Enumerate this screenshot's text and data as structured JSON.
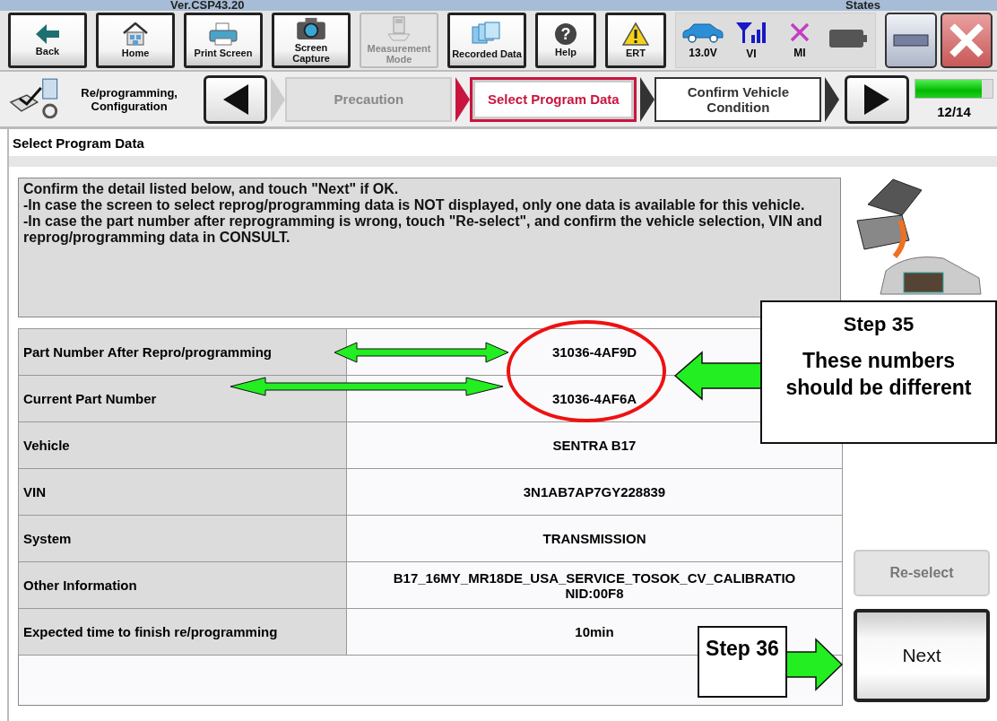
{
  "window": {
    "version": "Ver.CSP43.20",
    "status_label": "States"
  },
  "toolbar": {
    "buttons": [
      {
        "label": "Back",
        "disabled": false
      },
      {
        "label": "Home",
        "disabled": false
      },
      {
        "label": "Print Screen",
        "disabled": false
      },
      {
        "label": "Screen Capture",
        "disabled": false
      },
      {
        "label": "Measurement Mode",
        "disabled": true
      },
      {
        "label": "Recorded Data",
        "disabled": false
      },
      {
        "label": "Help",
        "glyph": "?",
        "disabled": false
      },
      {
        "label": "ERT",
        "disabled": false
      }
    ],
    "status": [
      {
        "label": "13.0V"
      },
      {
        "label": "VI"
      },
      {
        "label": "MI"
      }
    ]
  },
  "breadcrumb": {
    "section": "Re/programming, Configuration",
    "steps": [
      {
        "label": "Precaution",
        "selected": false,
        "disabled": true
      },
      {
        "label": "Select Program Data",
        "selected": true,
        "disabled": false
      },
      {
        "label": "Confirm Vehicle Condition",
        "selected": false,
        "disabled": false
      }
    ],
    "progress": {
      "level": 0.857,
      "text": "12/14"
    }
  },
  "page_title": "Select Program Data",
  "message": [
    "Confirm the detail listed below, and touch \"Next\" if OK.",
    "-In case the screen to select reprog/programming data is NOT displayed, only one data is available for this vehicle.",
    "-In case the part number after reprogramming is wrong, touch \"Re-select\", and confirm the vehicle selection, VIN and reprog/programming data in CONSULT."
  ],
  "table": {
    "rows": [
      {
        "label": "Part Number After Repro/programming",
        "value": "31036-4AF9D"
      },
      {
        "label": "Current Part Number",
        "value": "31036-4AF6A"
      },
      {
        "label": "Vehicle",
        "value": "SENTRA B17"
      },
      {
        "label": "VIN",
        "value": "3N1AB7AP7GY228839"
      },
      {
        "label": "System",
        "value": "TRANSMISSION"
      },
      {
        "label": "Other Information",
        "value": "B17_16MY_MR18DE_USA_SERVICE_TOSOK_CV_CALIBRATIO\nNID:00F8"
      },
      {
        "label": "Expected time to finish re/programming",
        "value": "10min"
      }
    ]
  },
  "actions": [
    {
      "label": "Re-select",
      "disabled": true
    },
    {
      "label": "Next",
      "disabled": false
    }
  ],
  "annotations": {
    "step35": {
      "title": "Step 35",
      "text": "These numbers should be different"
    },
    "step36": "Step 36"
  }
}
